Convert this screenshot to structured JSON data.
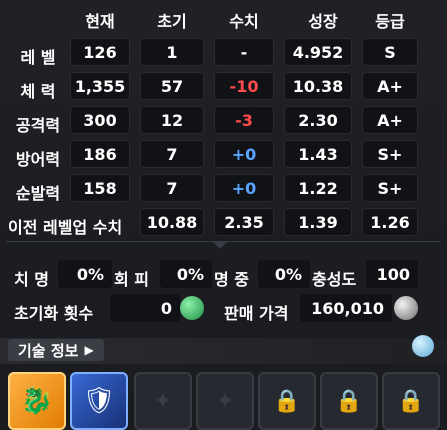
{
  "headers": [
    "현재",
    "초기",
    "수치",
    "성장",
    "등급"
  ],
  "rows": [
    {
      "label": "레 벨",
      "current": "126",
      "initial": "1",
      "value": "-",
      "value_color": "white",
      "growth": "4.952",
      "grade": "S"
    },
    {
      "label": "체 력",
      "current": "1,355",
      "initial": "57",
      "value": "-10",
      "value_color": "red",
      "growth": "10.38",
      "grade": "A+"
    },
    {
      "label": "공격력",
      "current": "300",
      "initial": "12",
      "value": "-3",
      "value_color": "red",
      "growth": "2.30",
      "grade": "A+"
    },
    {
      "label": "방어력",
      "current": "186",
      "initial": "7",
      "value": "+0",
      "value_color": "blue",
      "growth": "1.43",
      "grade": "S+"
    },
    {
      "label": "순발력",
      "current": "158",
      "initial": "7",
      "value": "+0",
      "value_color": "blue",
      "growth": "1.22",
      "grade": "S+"
    }
  ],
  "prev_levelup": {
    "label": "이전 레벨업 수치",
    "v1": "10.88",
    "v2": "2.35",
    "v3": "1.39",
    "v4": "1.26"
  },
  "stats2": {
    "crit_label": "치 명",
    "crit_value": "0%",
    "evade_label": "회 피",
    "evade_value": "0%",
    "accuracy_label": "명 중",
    "accuracy_value": "0%",
    "loyalty_label": "충성도",
    "loyalty_value": "100"
  },
  "reset": {
    "label": "초기화 횟수",
    "value": "0"
  },
  "sell": {
    "label": "판매 가격",
    "value": "160,010"
  },
  "skill_tab": {
    "label": "기술 정보"
  },
  "colors": {
    "red": "#ff4b4b",
    "blue": "#5aa3ff",
    "green_icon": "#3ec36a"
  }
}
